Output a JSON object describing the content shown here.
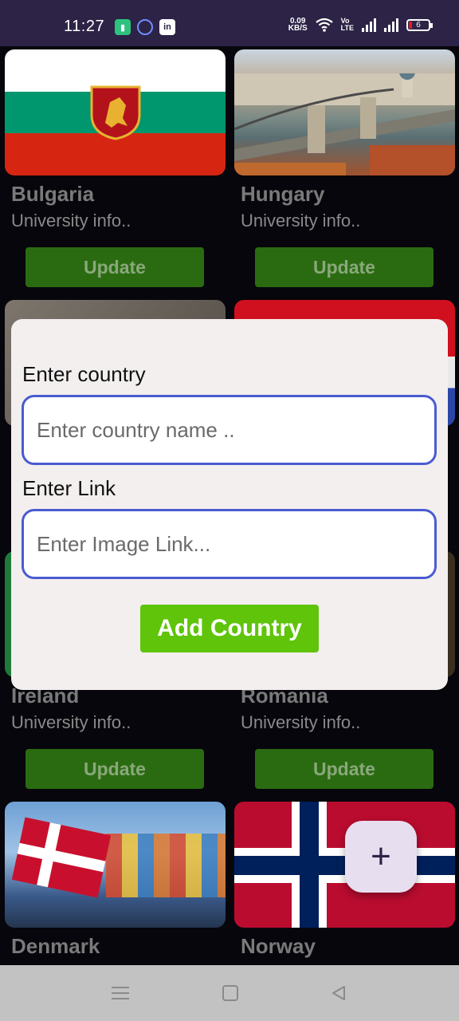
{
  "status_bar": {
    "time": "11:27",
    "net_speed_value": "0.09",
    "net_speed_unit": "KB/S",
    "volte_top": "Vo",
    "volte_bottom": "LTE",
    "battery_level": "6"
  },
  "countries": [
    {
      "name": "Bulgaria",
      "info": "University info..",
      "button": "Update"
    },
    {
      "name": "Hungary",
      "info": "University info..",
      "button": "Update"
    },
    {
      "name": "Ireland",
      "info": "University info..",
      "button": "Update"
    },
    {
      "name": "Romania",
      "info": "University info..",
      "button": "Update"
    },
    {
      "name": "Denmark"
    },
    {
      "name": "Norway"
    }
  ],
  "dialog": {
    "country_label": "Enter country",
    "country_placeholder": "Enter country name ..",
    "link_label": "Enter Link",
    "link_placeholder": "Enter Image Link...",
    "submit_label": "Add Country"
  },
  "fab": {
    "icon": "plus-icon",
    "glyph": "+"
  },
  "colors": {
    "update_button": "#2a6b12",
    "add_button": "#5fc40a",
    "input_border": "#4a5bd0",
    "status_bar": "#2c2346"
  }
}
